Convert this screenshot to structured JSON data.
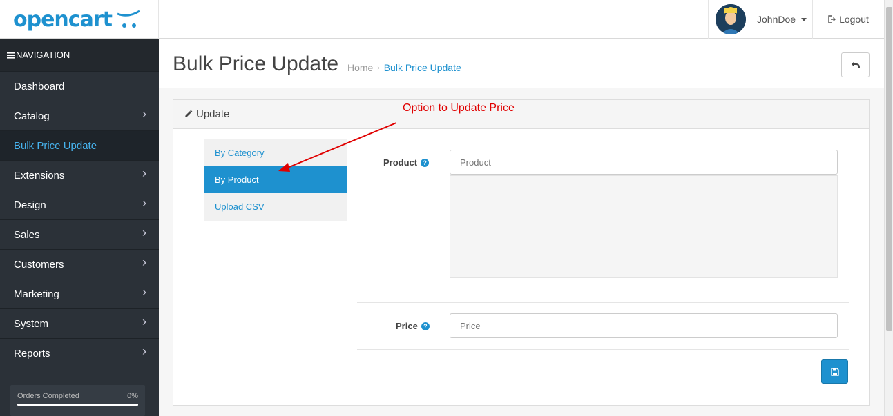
{
  "header": {
    "logo_text": "opencart",
    "user_name": "JohnDoe",
    "logout_label": "Logout"
  },
  "sidebar": {
    "nav_title": "NAVIGATION",
    "items": [
      {
        "label": "Dashboard",
        "has_arrow": false
      },
      {
        "label": "Catalog",
        "has_arrow": true
      },
      {
        "label": "Bulk Price Update",
        "has_arrow": false,
        "active": true
      },
      {
        "label": "Extensions",
        "has_arrow": true
      },
      {
        "label": "Design",
        "has_arrow": true
      },
      {
        "label": "Sales",
        "has_arrow": true
      },
      {
        "label": "Customers",
        "has_arrow": true
      },
      {
        "label": "Marketing",
        "has_arrow": true
      },
      {
        "label": "System",
        "has_arrow": true
      },
      {
        "label": "Reports",
        "has_arrow": true
      }
    ],
    "progress": {
      "label": "Orders Completed",
      "value": "0%",
      "fraction": 0
    }
  },
  "page": {
    "title": "Bulk Price Update",
    "breadcrumb": [
      "Home",
      "Bulk Price Update"
    ]
  },
  "panel": {
    "heading": "Update",
    "tabs": [
      {
        "label": "By Category",
        "active": false
      },
      {
        "label": "By Product",
        "active": true
      },
      {
        "label": "Upload CSV",
        "active": false
      }
    ],
    "product_label": "Product",
    "product_placeholder": "Product",
    "price_label": "Price",
    "price_placeholder": "Price"
  },
  "annotation": {
    "text": "Option to Update Price"
  },
  "colors": {
    "accent": "#1e91cf",
    "sidebar_bg": "#2b3138",
    "annotation": "#e00000"
  }
}
